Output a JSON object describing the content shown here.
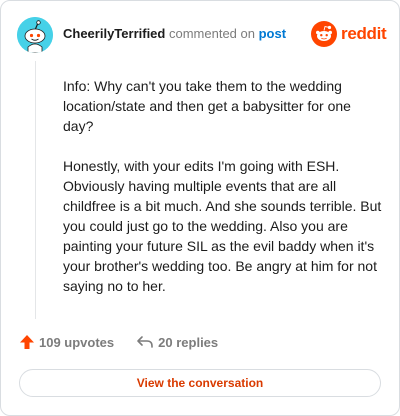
{
  "header": {
    "username": "CheerilyTerrified",
    "commented_on": "commented on",
    "post_link": "post",
    "brand": "reddit"
  },
  "comment": {
    "paragraphs": [
      "Info: Why can't you take them to the wedding location/state and then get a babysitter for one day?",
      "Honestly, with your edits I'm going with ESH. Obviously having multiple events that are all childfree is a bit much. And she sounds terrible. But you could just go to the wedding. Also you are painting your future SIL as the evil baddy when it's your brother's wedding too. Be angry at him for not saying no to her."
    ]
  },
  "actions": {
    "upvotes": "109 upvotes",
    "replies": "20 replies"
  },
  "button": {
    "label": "View the conversation"
  },
  "colors": {
    "brand": "#ff4500",
    "link": "#0079d3",
    "avatar_bg": "#46d1e8",
    "button_text": "#d93a00"
  },
  "icons": [
    "avatar-snoo",
    "reddit-logo-icon",
    "upvote-arrow-icon",
    "reply-arrow-icon"
  ]
}
